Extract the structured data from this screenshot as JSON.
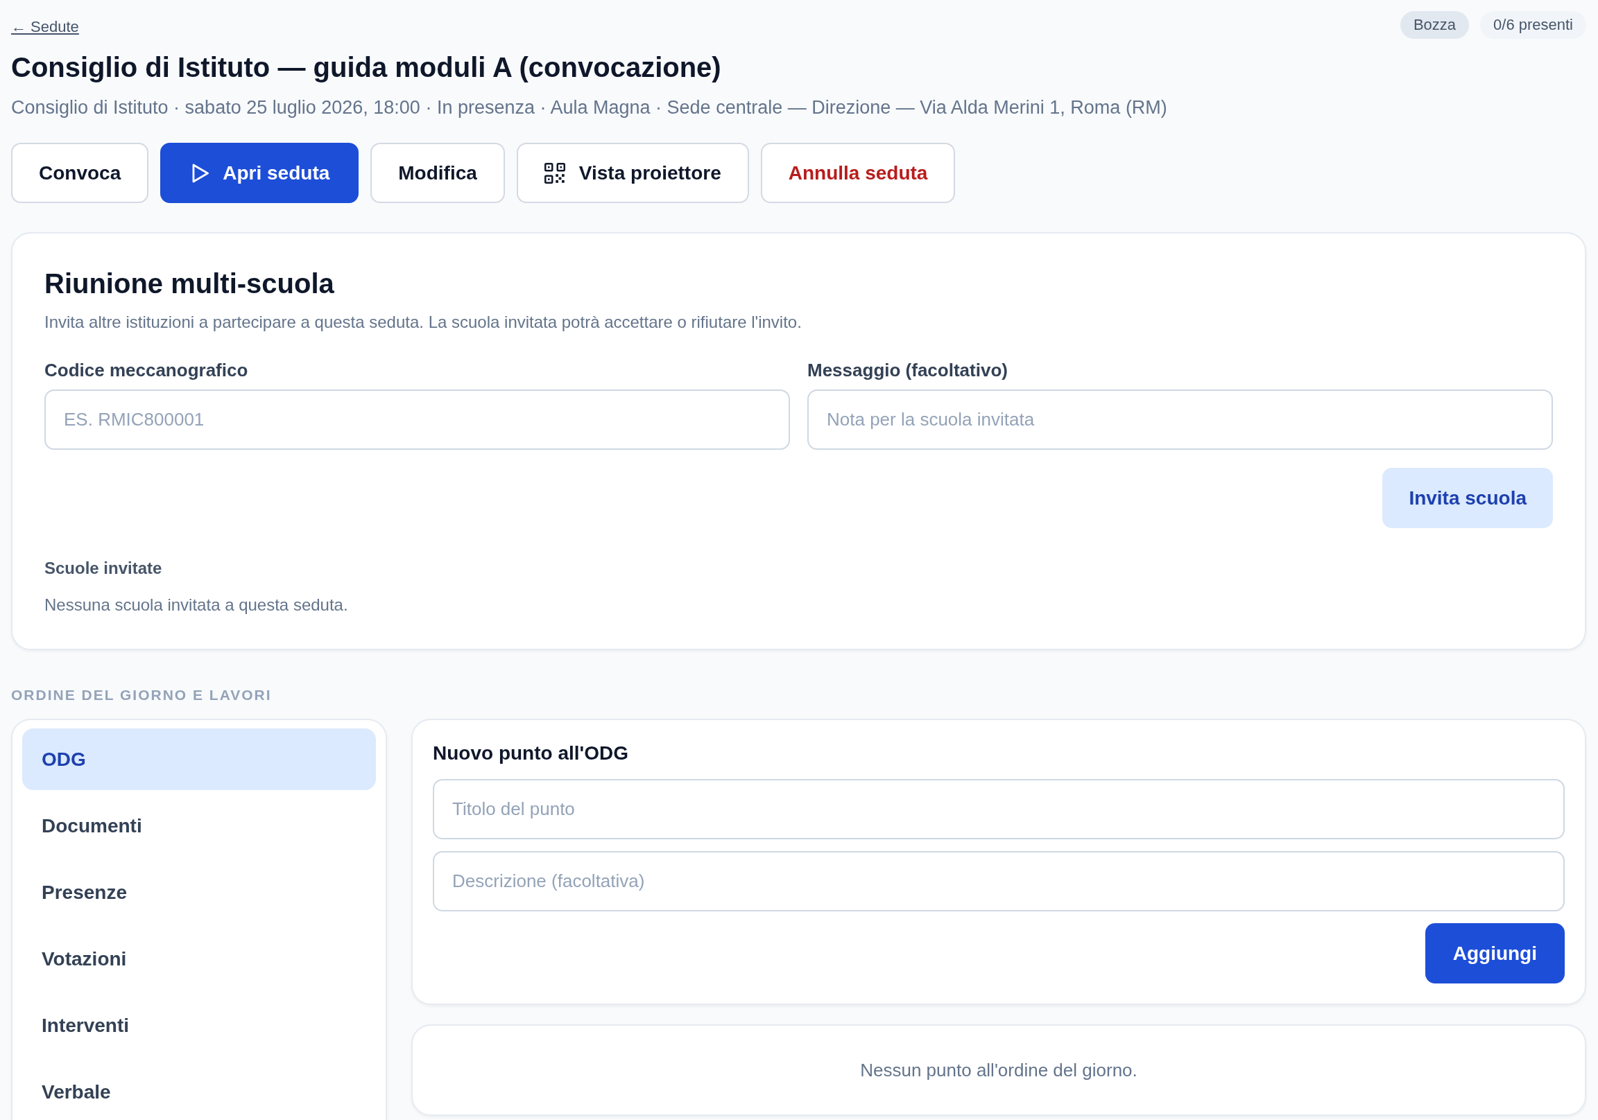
{
  "back_link": "← Sedute",
  "badges": [
    {
      "label": "Bozza",
      "kind": "status"
    },
    {
      "label": "0/6 presenti",
      "kind": "count"
    }
  ],
  "title": "Consiglio di Istituto — guida moduli A (convocazione)",
  "subtitle": "Consiglio di Istituto · sabato 25 luglio 2026, 18:00 · In presenza · Aula Magna · Sede centrale — Direzione — Via Alda Merini 1, Roma (RM)",
  "actions": [
    {
      "label": "Convoca",
      "kind": "plain"
    },
    {
      "label": "Apri seduta",
      "kind": "start"
    },
    {
      "label": "Modifica",
      "kind": "plain"
    },
    {
      "label": "Vista proiettore",
      "kind": "projector"
    },
    {
      "label": "Annulla seduta",
      "kind": "danger"
    }
  ],
  "multi_school": {
    "title": "Riunione multi-scuola",
    "description": "Invita altre istituzioni a partecipare a questa seduta. La scuola invitata potrà accettare o rifiutare l'invito.",
    "fields": [
      {
        "label": "Codice meccanografico",
        "placeholder": "ES. RMIC800001"
      },
      {
        "label": "Messaggio (facoltativo)",
        "placeholder": "Nota per la scuola invitata"
      }
    ],
    "submit": "Invita scuola",
    "invited_heading": "Scuole invitate",
    "empty_text": "Nessuna scuola invitata a questa seduta."
  },
  "agenda": {
    "heading": "ORDINE DEL GIORNO E LAVORI",
    "tabs": [
      {
        "label": "ODG",
        "selected": true
      },
      {
        "label": "Documenti",
        "selected": false
      },
      {
        "label": "Presenze",
        "selected": false
      },
      {
        "label": "Votazioni",
        "selected": false
      },
      {
        "label": "Interventi",
        "selected": false
      },
      {
        "label": "Verbale",
        "selected": false
      }
    ],
    "new_item": {
      "title": "Nuovo punto all'ODG",
      "fields": [
        {
          "placeholder": "Titolo del punto"
        },
        {
          "placeholder": "Descrizione (facoltativa)"
        }
      ],
      "submit": "Aggiungi"
    },
    "empty_text": "Nessun punto all'ordine del giorno."
  }
}
